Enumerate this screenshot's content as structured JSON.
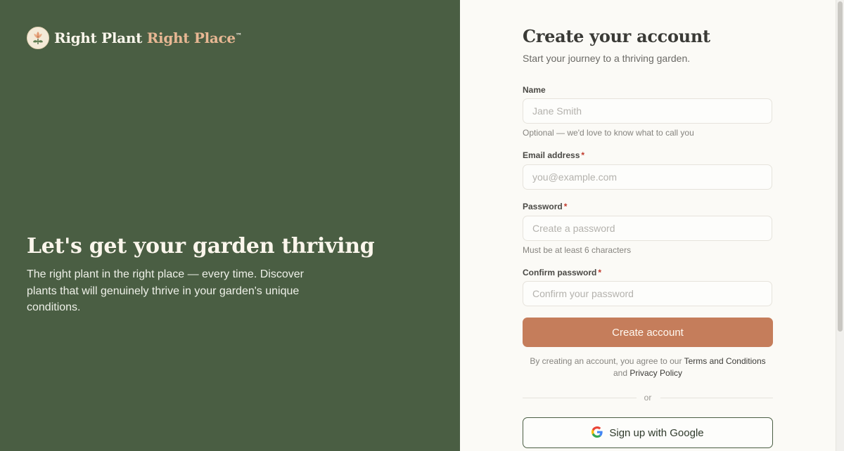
{
  "brand": {
    "part1": "Right Plant",
    "part2": "Right Place",
    "trademark": "™",
    "logo_icon": "flower-logo-icon",
    "accent_color": "#e7b793"
  },
  "hero": {
    "title": "Let's get your garden thriving",
    "description": "The right plant in the right place — every time. Discover plants that will genuinely thrive in your garden's unique conditions."
  },
  "form": {
    "title": "Create your account",
    "subtitle": "Start your journey to a thriving garden.",
    "required_marker": "*",
    "name": {
      "label": "Name",
      "placeholder": "Jane Smith",
      "value": "",
      "hint": "Optional — we'd love to know what to call you"
    },
    "email": {
      "label": "Email address",
      "placeholder": "you@example.com",
      "value": ""
    },
    "password": {
      "label": "Password",
      "placeholder": "Create a password",
      "value": "",
      "hint": "Must be at least 6 characters"
    },
    "confirm_password": {
      "label": "Confirm password",
      "placeholder": "Confirm your password",
      "value": ""
    },
    "submit_label": "Create account",
    "terms": {
      "prefix": "By creating an account, you agree to our",
      "terms_link": "Terms and Conditions",
      "conjunction": "and",
      "privacy_link": "Privacy Policy"
    },
    "divider_text": "or",
    "google_label": "Sign up with Google",
    "google_icon": "google-icon"
  },
  "colors": {
    "left_panel_bg": "#4a5e43",
    "primary_button": "#c57d5b",
    "page_bg": "#fbfaf6",
    "required": "#c0392b"
  }
}
